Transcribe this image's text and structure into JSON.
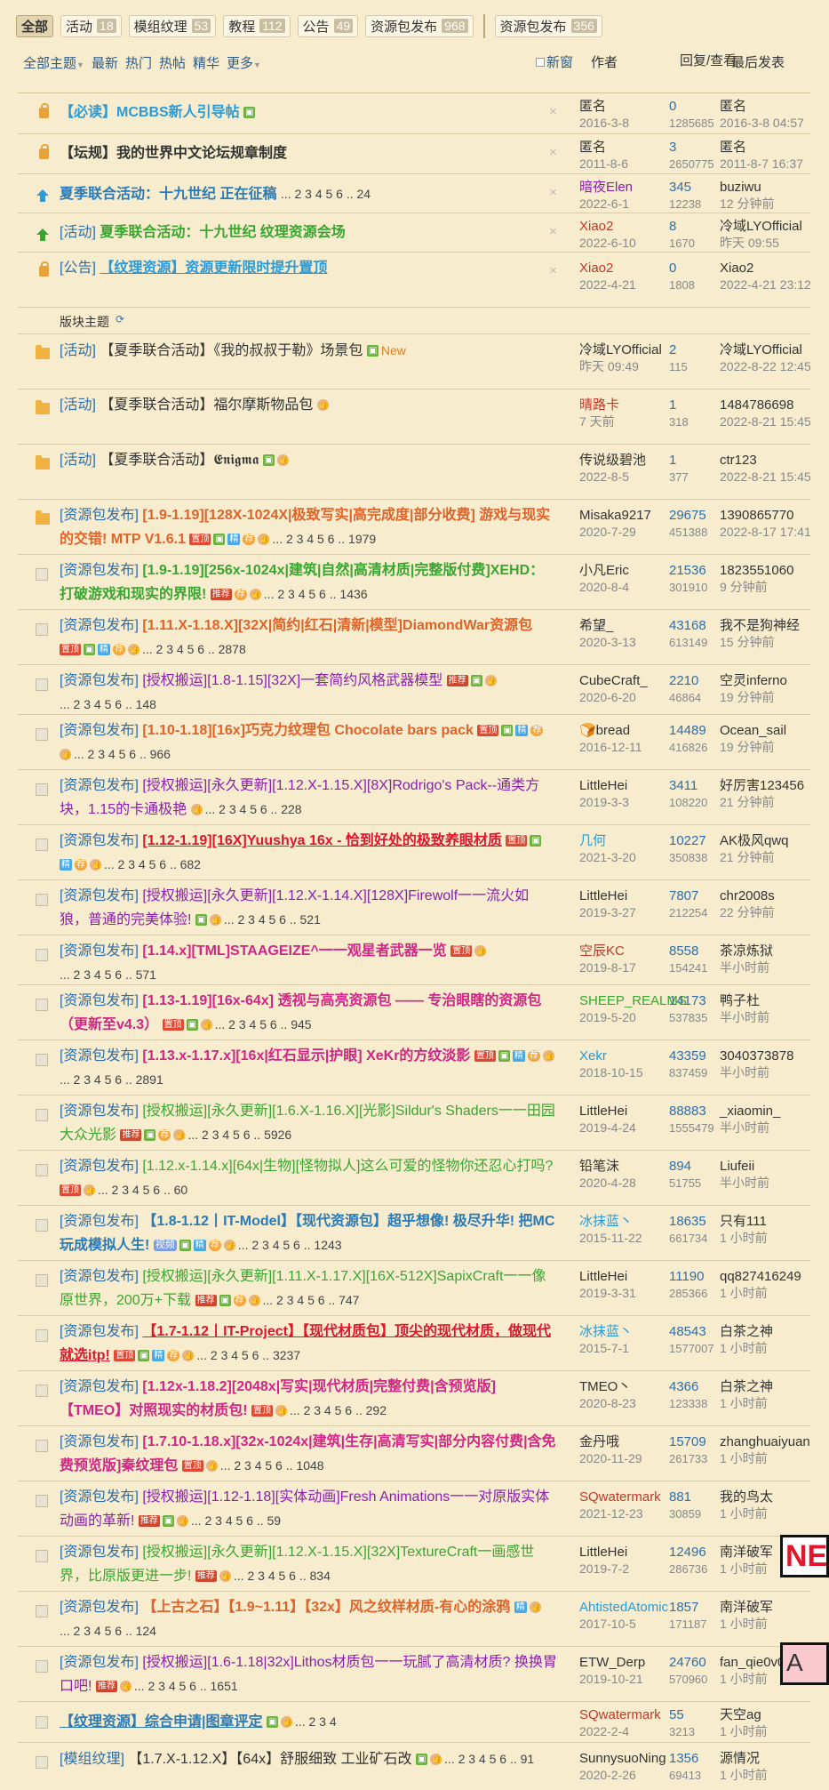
{
  "tabs": [
    {
      "label": "全部",
      "count": "",
      "active": true
    },
    {
      "label": "活动",
      "count": "18"
    },
    {
      "label": "模组纹理",
      "count": "53"
    },
    {
      "label": "教程",
      "count": "112"
    },
    {
      "label": "公告",
      "count": "49"
    },
    {
      "label": "资源包发布",
      "count": "968"
    },
    {
      "label": "资源包发布",
      "count": "356"
    }
  ],
  "filters": {
    "all_topics": "全部主题",
    "latest": "最新",
    "hot": "热门",
    "hot_posts": "热帖",
    "digest": "精华",
    "more": "更多",
    "new_window": "新窗"
  },
  "columns": {
    "author": "作者",
    "replies_views": "回复/查看",
    "last_post": "最后发表"
  },
  "colors": {
    "background": "#f7eccd",
    "link": "#2d6eab",
    "red": "#e0162c",
    "green": "#3aa530",
    "orange": "#e0632a",
    "magenta": "#d12685"
  },
  "rows": [
    {
      "icon": "lock",
      "tag": "",
      "title": "【必读】MCBBS新人引导帖",
      "color": "#2a9ad8",
      "bold": true,
      "badges": [
        "pic"
      ],
      "pages": "",
      "closeable": true,
      "author": "匿名",
      "author_color": "#333",
      "date": "2016-3-8",
      "replies": "0",
      "views": "1285685",
      "last_name": "匿名",
      "last_date": "2016-3-8 04:57",
      "h": 46
    },
    {
      "icon": "lock",
      "tag": "",
      "title": "【坛规】我的世界中文论坛规章制度",
      "color": "#333",
      "bold": true,
      "badges": [],
      "pages": "",
      "closeable": true,
      "author": "匿名",
      "author_color": "#333",
      "date": "2011-8-6",
      "replies": "3",
      "views": "2650775",
      "last_name": "匿名",
      "last_date": "2011-8-7 16:37",
      "h": 45
    },
    {
      "icon": "up-blue",
      "tag": "",
      "title": "夏季联合活动：十九世纪 正在征稿",
      "color": "#2a7ab8",
      "bold": true,
      "badges": [],
      "pages": "... 2 3 4 5 6 .. 24",
      "closeable": true,
      "author": "暗夜Elen",
      "author_color": "#8b1fae",
      "date": "2022-6-1",
      "replies": "345",
      "views": "12238",
      "last_name": "buziwu",
      "last_date": "12 分钟前",
      "h": 44
    },
    {
      "icon": "up-green",
      "tag": "[活动]",
      "title": "夏季联合活动：十九世纪 纹理资源会场",
      "color": "#3aa530",
      "bold": true,
      "badges": [],
      "pages": "",
      "closeable": true,
      "author": "Xiao2",
      "author_color": "#c0392b",
      "date": "2022-6-10",
      "replies": "8",
      "views": "1670",
      "last_name": "冷域LYOfficial",
      "last_date": "昨天 09:55",
      "h": 44
    },
    {
      "icon": "lock",
      "tag": "[公告]",
      "title": "【纹理资源】资源更新限时提升置顶",
      "color": "#2a9ad8",
      "bold": true,
      "underline": true,
      "badges": [],
      "pages": "",
      "closeable": true,
      "author": "Xiao2",
      "author_color": "#c0392b",
      "date": "2022-4-21",
      "replies": "0",
      "views": "1808",
      "last_name": "Xiao2",
      "last_date": "2022-4-21 23:12",
      "h": 62
    },
    {
      "type": "section",
      "label": "版块主题",
      "h": 30
    },
    {
      "icon": "folder",
      "tag": "[活动]",
      "title": "【夏季联合活动】《我的叔叔于勒》场景包",
      "color": "#333",
      "bold": false,
      "badges": [
        "pic"
      ],
      "pages": "",
      "newtag": "New",
      "author": "冷域LYOfficial",
      "author_color": "#333",
      "date": "昨天 09:49",
      "replies": "2",
      "views": "115",
      "last_name": "冷域LYOfficial",
      "last_date": "2022-8-22 12:45",
      "h": 62
    },
    {
      "icon": "folder",
      "tag": "[活动]",
      "title": "【夏季联合活动】福尔摩斯物品包",
      "color": "#333",
      "bold": false,
      "badges": [
        "hand"
      ],
      "pages": "",
      "author": "晴路卡",
      "author_color": "#c0392b",
      "date": "7 天前",
      "replies": "1",
      "views": "318",
      "last_name": "1484786698",
      "last_date": "2022-8-21 15:45",
      "h": 62
    },
    {
      "icon": "folder",
      "tag": "[活动]",
      "title": "【夏季联合活动】𝕰𝖓𝖎𝖌𝖒𝖆",
      "color": "#333",
      "bold": false,
      "badges": [
        "pic",
        "hand"
      ],
      "pages": "",
      "author": "传说级碧池",
      "author_color": "#333",
      "date": "2022-8-5",
      "replies": "1",
      "views": "377",
      "last_name": "ctr123",
      "last_date": "2022-8-21 15:45",
      "h": 62
    },
    {
      "icon": "folder",
      "tag": "[资源包发布]",
      "title": "[1.9-1.19][128X-1024X|极致写实|高完成度|部分收费] 游戏与现实的交错! MTP V1.6.1",
      "color": "#e0632a",
      "bold": true,
      "badges": [
        "hot",
        "pic",
        "rec",
        "fire",
        "hand"
      ],
      "pages": "... 2 3 4 5 6 .. 1979",
      "author": "Misaka9217",
      "author_color": "#333",
      "date": "2020-7-29",
      "replies": "29675",
      "views": "451388",
      "last_name": "1390865770",
      "last_date": "2022-8-17 17:41",
      "h": 62
    },
    {
      "icon": "doc",
      "tag": "[资源包发布]",
      "title": "[1.9-1.19][256x-1024x|建筑|自然|高清材质|完整版付费]XEHD：打破游戏和现实的界限!",
      "color": "#3aa530",
      "bold": true,
      "badges": [
        "dig",
        "fire",
        "hand"
      ],
      "pages": "... 2 3 4 5 6 .. 1436",
      "author": "小凡Eric",
      "author_color": "#333",
      "date": "2020-8-4",
      "replies": "21536",
      "views": "301910",
      "last_name": "1823551060",
      "last_date": "9 分钟前",
      "h": 62
    },
    {
      "icon": "doc",
      "tag": "[资源包发布]",
      "title": "[1.11.X-1.18.X][32X|简约|红石|清新|模型]DiamondWar资源包",
      "color": "#e0632a",
      "bold": true,
      "badges": [
        "hot",
        "pic",
        "rec",
        "fire",
        "hand"
      ],
      "pages": "... 2 3 4 5 6 .. 2878",
      "author": "希望_",
      "author_color": "#333",
      "date": "2020-3-13",
      "replies": "43168",
      "views": "613149",
      "last_name": "我不是狗神经",
      "last_date": "15 分钟前",
      "h": 62
    },
    {
      "icon": "doc",
      "tag": "[资源包发布]",
      "title": "[授权搬运][1.8-1.15][32X]一套简约风格武器模型",
      "color": "#8b1fae",
      "bold": false,
      "badges": [
        "dig",
        "pic",
        "hand"
      ],
      "pages": "... 2 3 4 5 6 .. 148",
      "author": "CubeCraft_",
      "author_color": "#333",
      "date": "2020-6-20",
      "replies": "2210",
      "views": "46864",
      "last_name": "空灵inferno",
      "last_date": "19 分钟前",
      "h": 56
    },
    {
      "icon": "doc",
      "tag": "[资源包发布]",
      "title": "[1.10-1.18][16x]巧克力纹理包 Chocolate bars pack",
      "color": "#e0632a",
      "bold": true,
      "badges": [
        "hot",
        "pic",
        "rec",
        "fire",
        "hand"
      ],
      "pages": "... 2 3 4 5 6 .. 966",
      "author": "🍞bread",
      "author_color": "#333",
      "date": "2016-12-11",
      "replies": "14489",
      "views": "416826",
      "last_name": "Ocean_sail",
      "last_date": "19 分钟前",
      "h": 62
    },
    {
      "icon": "doc",
      "tag": "[资源包发布]",
      "title": "[授权搬运][永久更新][1.12.X-1.15.X][8X]Rodrigo's Pack--通类方块，1.15的卡通极艳",
      "color": "#8b1fae",
      "bold": false,
      "badges": [
        "hand"
      ],
      "pages": "... 2 3 4 5 6 .. 228",
      "author": "LittleHei",
      "author_color": "#333",
      "date": "2019-3-3",
      "replies": "3411",
      "views": "108220",
      "last_name": "好厉害123456",
      "last_date": "21 分钟前",
      "h": 62
    },
    {
      "icon": "doc",
      "tag": "[资源包发布]",
      "title": "[1.12-1.19][16X]Yuushya 16x - 恰到好处的极致养眼材质",
      "color": "#e0162c",
      "bold": true,
      "underline": true,
      "badges": [
        "hot",
        "pic",
        "rec",
        "fire",
        "hand"
      ],
      "pages": "... 2 3 4 5 6 .. 682",
      "author": "几何",
      "author_color": "#2a9ad8",
      "date": "2021-3-20",
      "replies": "10227",
      "views": "350838",
      "last_name": "AK极风qwq",
      "last_date": "21 分钟前",
      "h": 62
    },
    {
      "icon": "doc",
      "tag": "[资源包发布]",
      "title": "[授权搬运][永久更新][1.12.X-1.14.X][128X]Firewolf一一流火如狼，普通的完美体验!",
      "color": "#8b1fae",
      "bold": false,
      "badges": [
        "pic",
        "hand"
      ],
      "pages": "... 2 3 4 5 6 .. 521",
      "author": "LittleHei",
      "author_color": "#333",
      "date": "2019-3-27",
      "replies": "7807",
      "views": "212254",
      "last_name": "chr2008s",
      "last_date": "22 分钟前",
      "h": 62
    },
    {
      "icon": "doc",
      "tag": "[资源包发布]",
      "title": "[1.14.x][TML]STAAGEIZE^一一观星者武器一览",
      "color": "#d12685",
      "bold": true,
      "badges": [
        "hot",
        "hand"
      ],
      "pages": "... 2 3 4 5 6 .. 571",
      "author": "空辰KC",
      "author_color": "#c0392b",
      "date": "2019-8-17",
      "replies": "8558",
      "views": "154241",
      "last_name": "茶凉炼狱",
      "last_date": "半小时前",
      "h": 56
    },
    {
      "icon": "doc",
      "tag": "[资源包发布]",
      "title": "[1.13-1.19][16x-64x] 透视与高亮资源包 —— 专治眼瞎的资源包（更新至v4.3）",
      "color": "#d12685",
      "bold": true,
      "badges": [
        "hot",
        "pic",
        "hand"
      ],
      "pages": "... 2 3 4 5 6 .. 945",
      "author": "SHEEP_REALMS",
      "author_color": "#3aa530",
      "date": "2019-5-20",
      "replies": "14173",
      "views": "537835",
      "last_name": "鸭子杜",
      "last_date": "半小时前",
      "h": 62
    },
    {
      "icon": "doc",
      "tag": "[资源包发布]",
      "title": "[1.13.x-1.17.x][16x|红石显示|护眼] XeKr的方纹淡影",
      "color": "#d12685",
      "bold": true,
      "badges": [
        "hot",
        "pic",
        "rec",
        "fire",
        "hand"
      ],
      "pages": "... 2 3 4 5 6 .. 2891",
      "author": "Xekr",
      "author_color": "#2a9ad8",
      "date": "2018-10-15",
      "replies": "43359",
      "views": "837459",
      "last_name": "3040373878",
      "last_date": "半小时前",
      "h": 62
    },
    {
      "icon": "doc",
      "tag": "[资源包发布]",
      "title": "[授权搬运][永久更新][1.6.X-1.16.X][光影]Sildur's Shaders一一田园大众光影",
      "color": "#3aa530",
      "bold": false,
      "badges": [
        "dig",
        "pic",
        "fire",
        "hand"
      ],
      "pages": "... 2 3 4 5 6 .. 5926",
      "author": "LittleHei",
      "author_color": "#333",
      "date": "2019-4-24",
      "replies": "88883",
      "views": "1555479",
      "last_name": "_xiaomin_",
      "last_date": "半小时前",
      "h": 62
    },
    {
      "icon": "doc",
      "tag": "[资源包发布]",
      "title": "[1.12.x-1.14.x][64x|生物][怪物拟人]这么可爱的怪物你还忍心打吗?",
      "color": "#3aa530",
      "bold": false,
      "badges": [
        "hot",
        "hand"
      ],
      "pages": "... 2 3 4 5 6 .. 60",
      "author": "铅笔沫",
      "author_color": "#333",
      "date": "2020-4-28",
      "replies": "894",
      "views": "51755",
      "last_name": "Liufeii",
      "last_date": "半小时前",
      "h": 62
    },
    {
      "icon": "doc",
      "tag": "[资源包发布]",
      "title": "【1.8-1.12丨IT-Model】【现代资源包】超乎想像! 极尽升华! 把MC玩成模拟人生!",
      "color": "#2a7ab8",
      "bold": true,
      "badges": [
        "pic",
        "rec",
        "fire",
        "hand"
      ],
      "star": true,
      "pages": "... 2 3 4 5 6 .. 1243",
      "author": "冰抹蓝丶",
      "author_color": "#2a9ad8",
      "date": "2015-11-22",
      "replies": "18635",
      "views": "661734",
      "last_name": "只有111",
      "last_date": "1 小时前",
      "h": 62
    },
    {
      "icon": "doc",
      "tag": "[资源包发布]",
      "title": "[授权搬运][永久更新][1.11.X-1.17.X][16X-512X]SapixCraft一一像原世界，200万+下载",
      "color": "#3aa530",
      "bold": false,
      "badges": [
        "dig",
        "pic",
        "fire",
        "hand"
      ],
      "pages": "... 2 3 4 5 6 .. 747",
      "author": "LittleHei",
      "author_color": "#333",
      "date": "2019-3-31",
      "replies": "11190",
      "views": "285366",
      "last_name": "qq827416249",
      "last_date": "1 小时前",
      "h": 62
    },
    {
      "icon": "doc",
      "tag": "[资源包发布]",
      "title": "【1.7-1.12丨IT-Project】【现代材质包】顶尖的现代材质，做现代就选itp!",
      "color": "#e0162c",
      "bold": true,
      "underline": true,
      "badges": [
        "hot",
        "pic",
        "rec",
        "fire",
        "hand"
      ],
      "pages": "... 2 3 4 5 6 .. 3237",
      "author": "冰抹蓝丶",
      "author_color": "#2a9ad8",
      "date": "2015-7-1",
      "replies": "48543",
      "views": "1577007",
      "last_name": "白茶之神",
      "last_date": "1 小时前",
      "h": 62
    },
    {
      "icon": "doc",
      "tag": "[资源包发布]",
      "title": "[1.12x-1.18.2][2048x|写实|现代材质|完整付费|含预览版]【TMEO】对照现实的材质包!",
      "color": "#d12685",
      "bold": true,
      "badges": [
        "hot",
        "hand"
      ],
      "pages": "... 2 3 4 5 6 .. 292",
      "author": "TMEO丶",
      "author_color": "#333",
      "date": "2020-8-23",
      "replies": "4366",
      "views": "123338",
      "last_name": "白茶之神",
      "last_date": "1 小时前",
      "h": 62
    },
    {
      "icon": "doc",
      "tag": "[资源包发布]",
      "title": "[1.7.10-1.18.x][32x-1024x|建筑|生存|高清写实|部分内容付费|含免费预览版]秦纹理包",
      "color": "#d12685",
      "bold": true,
      "badges": [
        "hot",
        "hand"
      ],
      "pages": "... 2 3 4 5 6 .. 1048",
      "author": "金丹哦",
      "author_color": "#333",
      "date": "2020-11-29",
      "replies": "15709",
      "views": "261733",
      "last_name": "zhanghuaiyuan",
      "last_date": "1 小时前",
      "h": 62
    },
    {
      "icon": "doc",
      "tag": "[资源包发布]",
      "title": "[授权搬运][1.12-1.18][实体动画]Fresh Animations一一对原版实体动画的革新!",
      "color": "#8b1fae",
      "bold": false,
      "badges": [
        "dig",
        "pic",
        "hand"
      ],
      "pages": "... 2 3 4 5 6 .. 59",
      "author": "SQwatermark",
      "author_color": "#c0392b",
      "date": "2021-12-23",
      "replies": "881",
      "views": "30859",
      "last_name": "我的鸟太",
      "last_date": "1 小时前",
      "h": 62
    },
    {
      "icon": "doc",
      "tag": "[资源包发布]",
      "title": "[授权搬运][永久更新][1.12.X-1.15.X][32X]TextureCraft一画感世界，比原版更进一步!",
      "color": "#3aa530",
      "bold": false,
      "badges": [
        "dig",
        "hand"
      ],
      "pages": "... 2 3 4 5 6 .. 834",
      "author": "LittleHei",
      "author_color": "#333",
      "date": "2019-7-2",
      "replies": "12496",
      "views": "286736",
      "last_name": "南洋破军",
      "last_date": "1 小时前",
      "h": 62
    },
    {
      "icon": "doc",
      "tag": "[资源包发布]",
      "title": "【上古之石】【1.9~1.11】【32x】风之纹样材质-有心的涂鸦",
      "color": "#e0632a",
      "bold": true,
      "badges": [
        "rec",
        "hand"
      ],
      "pages": "... 2 3 4 5 6 .. 124",
      "author": "AhtistedAtomic",
      "author_color": "#2a9ad8",
      "date": "2017-10-5",
      "replies": "1857",
      "views": "171187",
      "last_name": "南洋破军",
      "last_date": "1 小时前",
      "h": 62
    },
    {
      "icon": "doc",
      "tag": "[资源包发布]",
      "title": "[授权搬运][1.6-1.18|32x]Lithos材质包一一玩腻了高清材质? 换换胃口吧!",
      "color": "#8b1fae",
      "bold": false,
      "badges": [
        "dig",
        "hand"
      ],
      "pages": "... 2 3 4 5 6 .. 1651",
      "author": "ETW_Derp",
      "author_color": "#333",
      "date": "2019-10-21",
      "replies": "24760",
      "views": "570960",
      "last_name": "fan_qie0v0",
      "last_date": "1 小时前",
      "h": 62
    },
    {
      "icon": "doc",
      "tag": "",
      "title": "【纹理资源】综合申请|图章评定",
      "color": "#2a7ab8",
      "bold": true,
      "underline": true,
      "badges": [
        "pic",
        "hand"
      ],
      "pages": "... 2 3 4",
      "author": "SQwatermark",
      "author_color": "#c0392b",
      "date": "2022-2-4",
      "replies": "55",
      "views": "3213",
      "last_name": "天空ag",
      "last_date": "1 小时前",
      "h": 46
    },
    {
      "icon": "doc",
      "tag": "[模组纹理]",
      "title": "【1.7.X-1.12.X】【64x】舒服细致 工业矿石改",
      "color": "#333",
      "bold": false,
      "badges": [
        "pic",
        "hand"
      ],
      "pages": "... 2 3 4 5 6 .. 91",
      "author": "SunnysuoNing",
      "author_color": "#333",
      "date": "2020-2-26",
      "replies": "1356",
      "views": "69413",
      "last_name": "源情况",
      "last_date": "1 小时前",
      "h": 62
    }
  ],
  "edge": {
    "label1": "NE",
    "label2": "A"
  }
}
